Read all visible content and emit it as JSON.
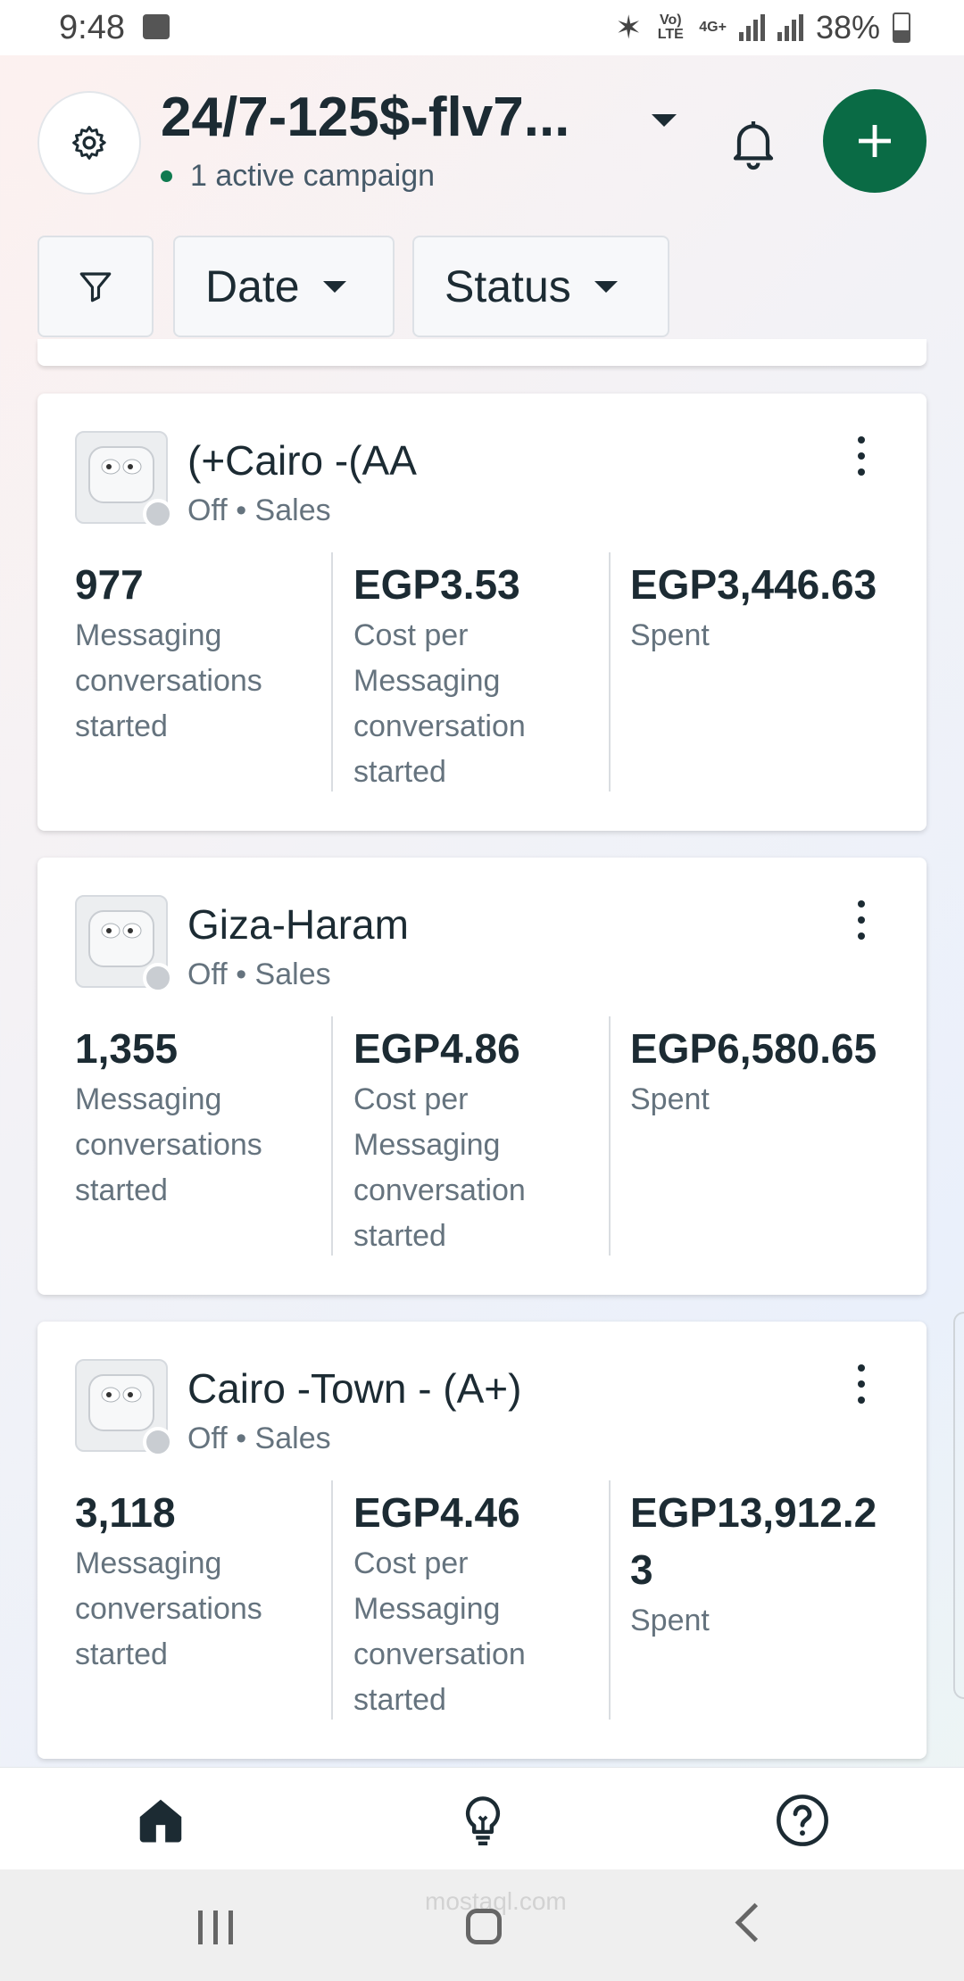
{
  "status_bar": {
    "time": "9:48",
    "net_top": "4G+",
    "net_lte": "Vo) LTE",
    "battery_text": "38%"
  },
  "header": {
    "account_name": "24/7-125$-flv7...",
    "active_text": "1 active campaign",
    "accent_color": "#0a6b45"
  },
  "filters": {
    "date_label": "Date",
    "status_label": "Status"
  },
  "campaigns": [
    {
      "name": "(+Cairo -(AA",
      "status": "Off",
      "separator": "•",
      "objective": "Sales",
      "metric1_value": "977",
      "metric1_label": "Messaging conversations started",
      "metric2_value": "EGP3.53",
      "metric2_label": "Cost per Messaging conversation started",
      "metric3_value": "EGP3,446.63",
      "metric3_label": "Spent"
    },
    {
      "name": "Giza-Haram",
      "status": "Off",
      "separator": "•",
      "objective": "Sales",
      "metric1_value": "1,355",
      "metric1_label": "Messaging conversations started",
      "metric2_value": "EGP4.86",
      "metric2_label": "Cost per Messaging conversation started",
      "metric3_value": "EGP6,580.65",
      "metric3_label": "Spent"
    },
    {
      "name": "Cairo -Town - (A+)",
      "status": "Off",
      "separator": "•",
      "objective": "Sales",
      "metric1_value": "3,118",
      "metric1_label": "Messaging conversations started",
      "metric2_value": "EGP4.46",
      "metric2_label": "Cost per Messaging conversation started",
      "metric3_value": "EGP13,912.23",
      "metric3_label": "Spent"
    }
  ],
  "watermark": "mostaql.com",
  "icons": {
    "settings": "gear-icon",
    "account_dropdown": "caret-down-icon",
    "notifications": "bell-icon",
    "create": "plus-icon",
    "filter": "filter-icon",
    "campaign_menu": "kebab-menu-icon",
    "tab_home": "home-icon",
    "tab_ideas": "lightbulb-icon",
    "tab_help": "help-icon"
  }
}
